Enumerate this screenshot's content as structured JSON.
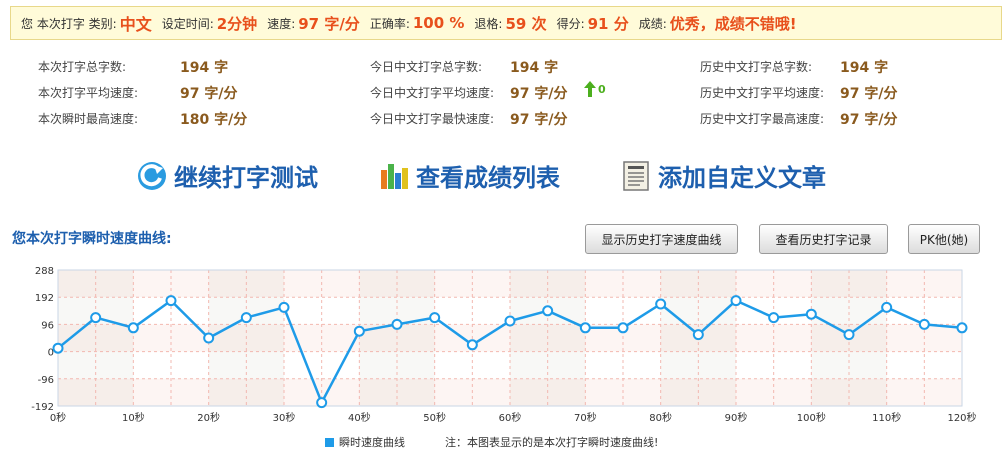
{
  "summary": {
    "prefix": "您 本次打字 类别:",
    "category": "中文",
    "time_label": "设定时间:",
    "time_value": "2分钟",
    "speed_label": "速度:",
    "speed_value": "97 字/分",
    "accuracy_label": "正确率:",
    "accuracy_value": "100 %",
    "backspace_label": "退格:",
    "backspace_value": "59 次",
    "score_label": "得分:",
    "score_value": "91 分",
    "grade_label": "成绩:",
    "grade_value": "优秀，成绩不错哦!"
  },
  "stats": {
    "col1": [
      {
        "label": "本次打字总字数:",
        "value": "194 字"
      },
      {
        "label": "本次打字平均速度:",
        "value": "97 字/分"
      },
      {
        "label": "本次瞬时最高速度:",
        "value": "180 字/分"
      }
    ],
    "col2": [
      {
        "label": "今日中文打字总字数:",
        "value": "194 字"
      },
      {
        "label": "今日中文打字平均速度:",
        "value": "97 字/分",
        "trend": "0"
      },
      {
        "label": "今日中文打字最快速度:",
        "value": "97 字/分"
      }
    ],
    "col3": [
      {
        "label": "历史中文打字总字数:",
        "value": "194 字"
      },
      {
        "label": "历史中文打字平均速度:",
        "value": "97 字/分"
      },
      {
        "label": "历史中文打字最高速度:",
        "value": "97 字/分"
      }
    ]
  },
  "actions": {
    "continue": "继续打字测试",
    "scores": "查看成绩列表",
    "custom": "添加自定义文章"
  },
  "section_title": "您本次打字瞬时速度曲线:",
  "buttons": {
    "history_curve": "显示历史打字速度曲线",
    "history_records": "查看历史打字记录",
    "pk": "PK他(她)"
  },
  "legend": {
    "series": "瞬时速度曲线",
    "note": "注：本图表显示的是本次打字瞬时速度曲线!"
  },
  "colors": {
    "accent": "#1d5fae",
    "highlight": "#e8501c",
    "line": "#1e9be8"
  },
  "chart_data": {
    "type": "line",
    "x": [
      0,
      5,
      10,
      15,
      20,
      25,
      30,
      35,
      40,
      45,
      50,
      55,
      60,
      65,
      70,
      75,
      80,
      85,
      90,
      95,
      100,
      105,
      110,
      115,
      120
    ],
    "x_ticks": [
      "0秒",
      "10秒",
      "20秒",
      "30秒",
      "40秒",
      "50秒",
      "60秒",
      "70秒",
      "80秒",
      "90秒",
      "100秒",
      "110秒",
      "120秒"
    ],
    "y_ticks": [
      "288",
      "192",
      "96",
      "0",
      "-96",
      "-192"
    ],
    "ylim": [
      -192,
      288
    ],
    "xlim": [
      0,
      120
    ],
    "series": [
      {
        "name": "瞬时速度曲线",
        "values": [
          12,
          120,
          84,
          180,
          48,
          120,
          156,
          -180,
          72,
          96,
          120,
          24,
          108,
          144,
          84,
          84,
          168,
          60,
          180,
          120,
          132,
          60,
          156,
          96,
          84
        ]
      }
    ],
    "grid": true
  }
}
